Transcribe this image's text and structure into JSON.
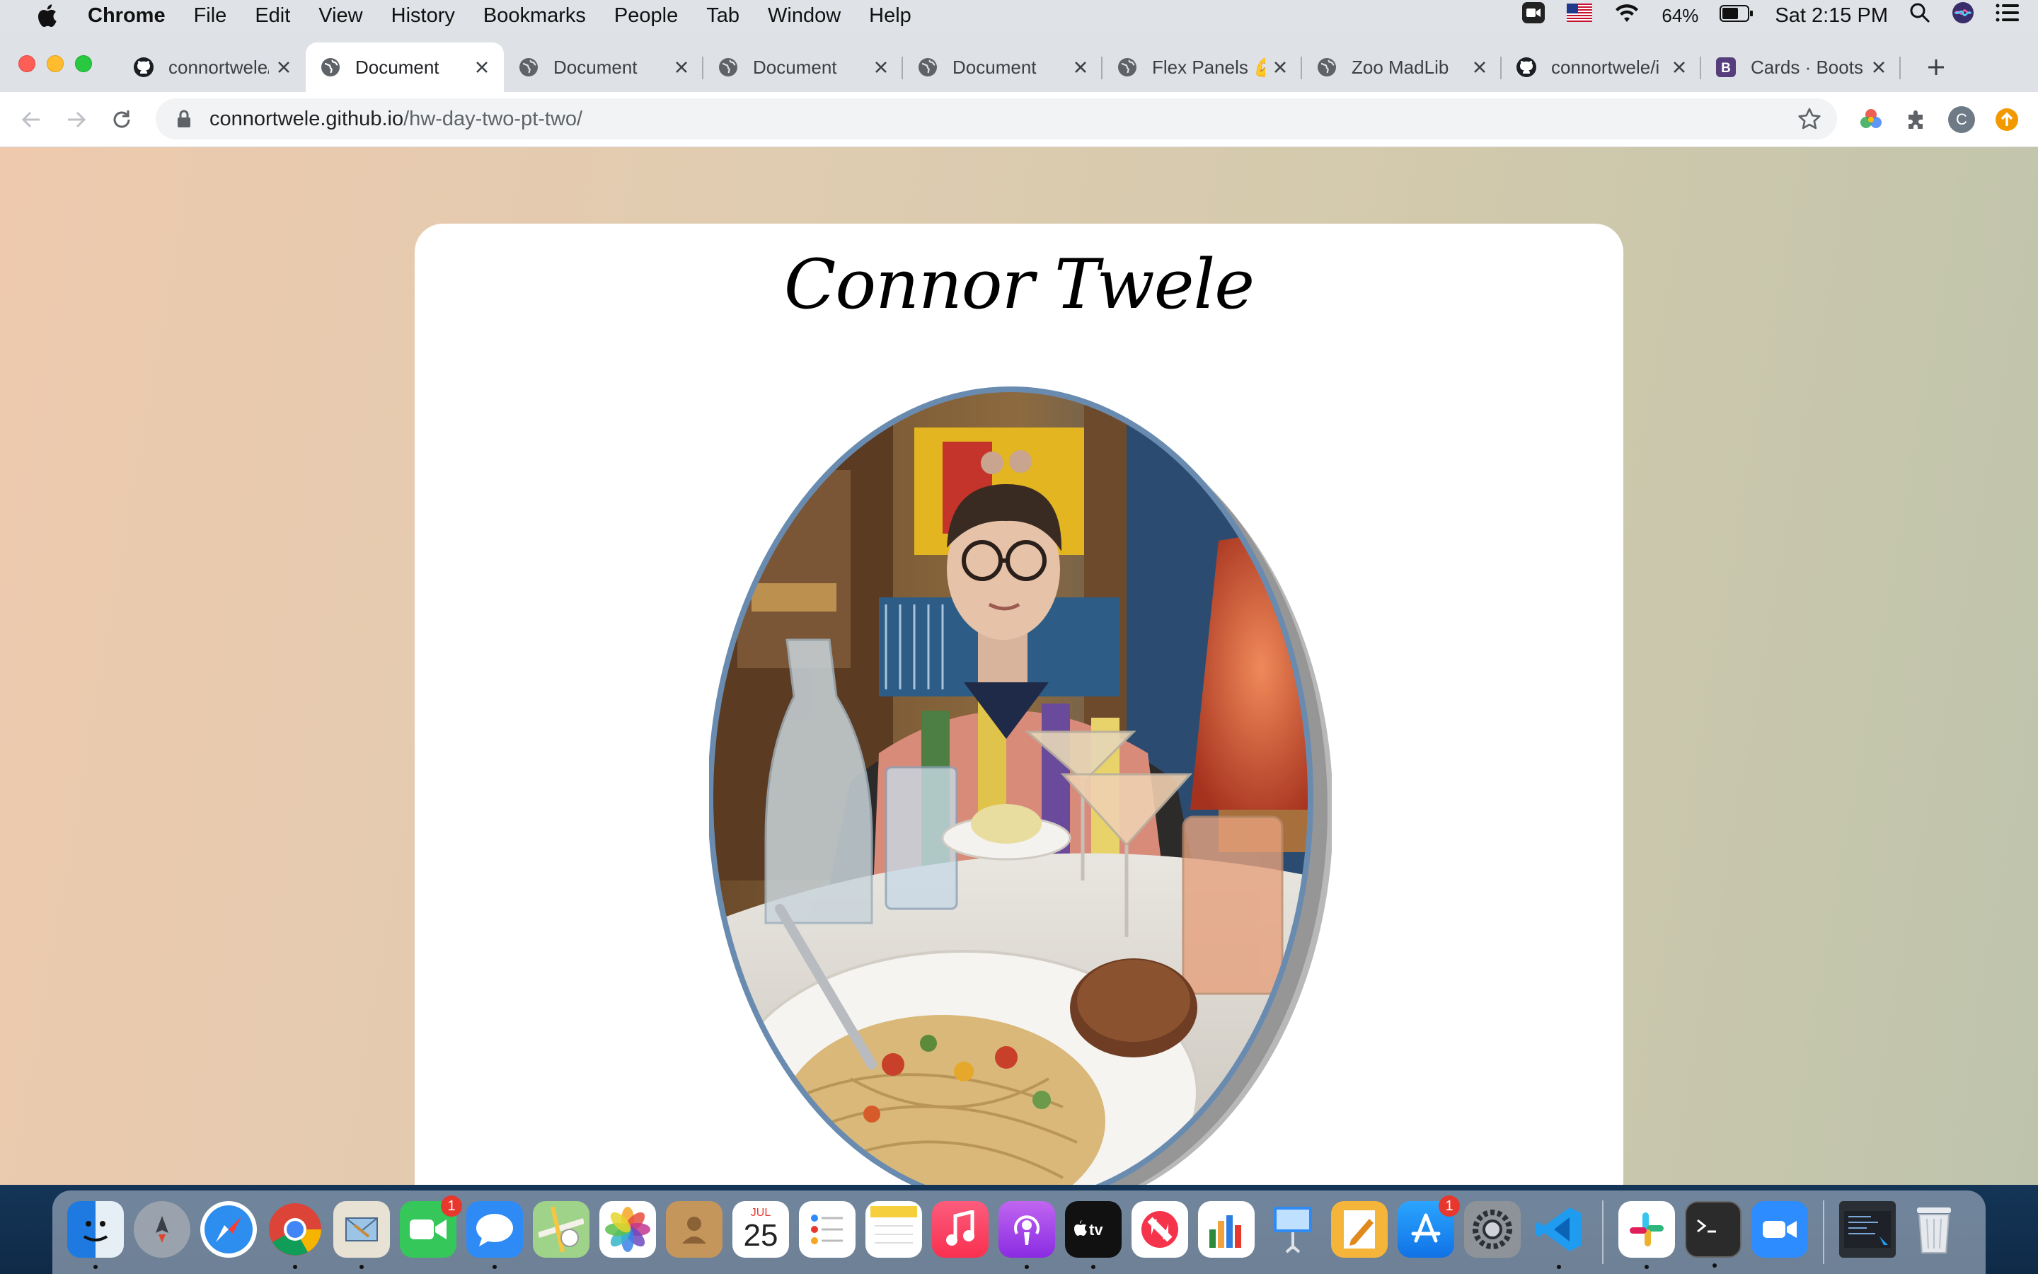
{
  "menubar": {
    "app_name": "Chrome",
    "items": [
      "File",
      "Edit",
      "View",
      "History",
      "Bookmarks",
      "People",
      "Tab",
      "Window",
      "Help"
    ],
    "battery_percent": "64%",
    "clock": "Sat 2:15 PM"
  },
  "tabs": [
    {
      "title": "connortwele/i",
      "icon": "github-icon"
    },
    {
      "title": "Document",
      "icon": "globe-icon",
      "active": true
    },
    {
      "title": "Document",
      "icon": "globe-icon"
    },
    {
      "title": "Document",
      "icon": "globe-icon"
    },
    {
      "title": "Document",
      "icon": "globe-icon"
    },
    {
      "title": "Flex Panels 💪",
      "icon": "globe-icon"
    },
    {
      "title": "Zoo MadLib",
      "icon": "globe-icon"
    },
    {
      "title": "connortwele/i",
      "icon": "github-icon"
    },
    {
      "title": "Cards · Boots",
      "icon": "bootstrap-icon"
    }
  ],
  "address_bar": {
    "host": "connortwele.github.io",
    "path": "/hw-day-two-pt-two/"
  },
  "profile_initial": "C",
  "page": {
    "name": "Connor Twele"
  },
  "dock": {
    "calendar_month": "JUL",
    "calendar_day": "25",
    "facetime_badge": "1",
    "appstore_badge": "1"
  }
}
